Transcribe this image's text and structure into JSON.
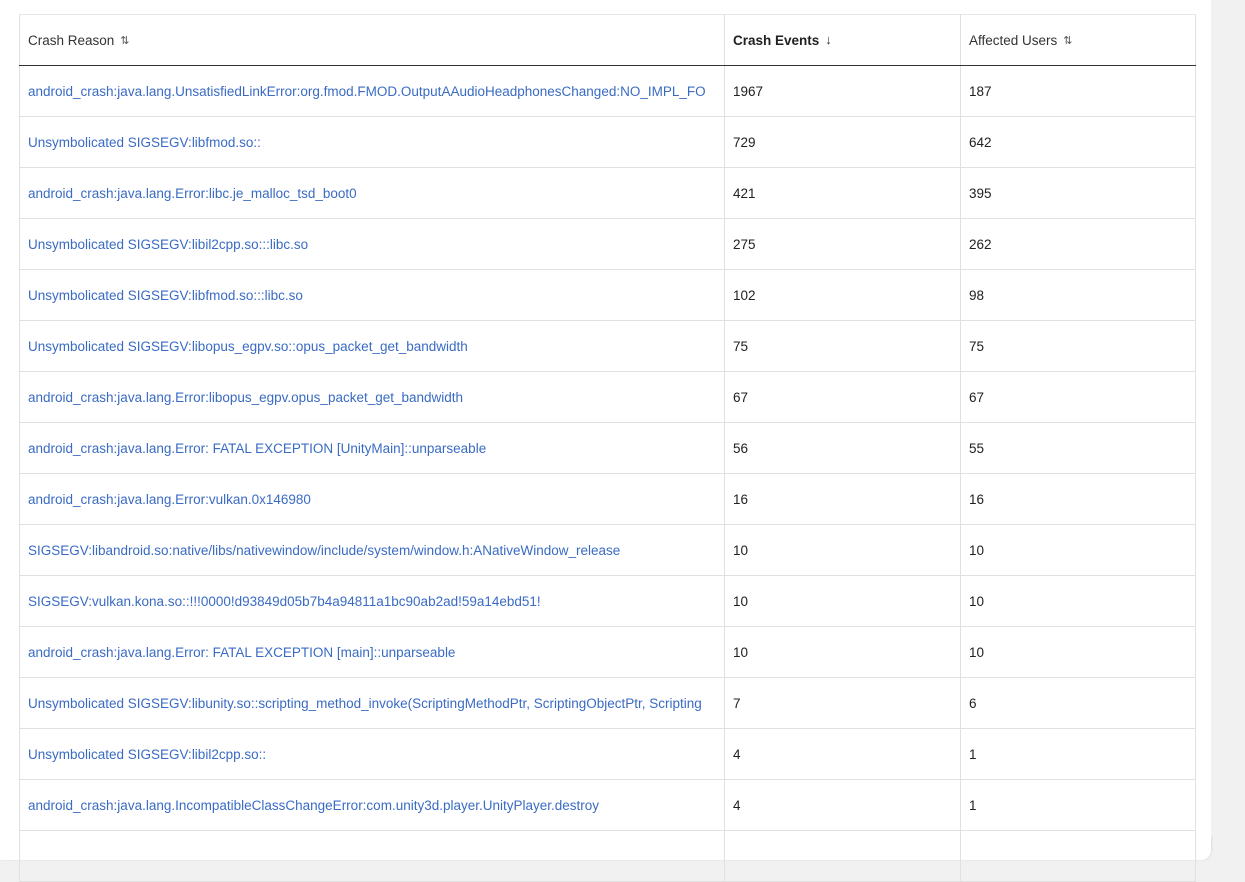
{
  "table": {
    "columns": [
      {
        "label": "Crash Reason",
        "sort_icon": "⇅",
        "sorted": false
      },
      {
        "label": "Crash Events",
        "sort_icon": "↓",
        "sorted": true
      },
      {
        "label": "Affected Users",
        "sort_icon": "⇅",
        "sorted": false
      }
    ],
    "rows": [
      {
        "reason": "android_crash:java.lang.UnsatisfiedLinkError:org.fmod.FMOD.OutputAAudioHeadphonesChanged:NO_IMPL_FO",
        "events": "1967",
        "users": "187"
      },
      {
        "reason": "Unsymbolicated SIGSEGV:libfmod.so::",
        "events": "729",
        "users": "642"
      },
      {
        "reason": "android_crash:java.lang.Error:libc.je_malloc_tsd_boot0",
        "events": "421",
        "users": "395"
      },
      {
        "reason": "Unsymbolicated SIGSEGV:libil2cpp.so:::libc.so",
        "events": "275",
        "users": "262"
      },
      {
        "reason": "Unsymbolicated SIGSEGV:libfmod.so:::libc.so",
        "events": "102",
        "users": "98"
      },
      {
        "reason": "Unsymbolicated SIGSEGV:libopus_egpv.so::opus_packet_get_bandwidth",
        "events": "75",
        "users": "75"
      },
      {
        "reason": "android_crash:java.lang.Error:libopus_egpv.opus_packet_get_bandwidth",
        "events": "67",
        "users": "67"
      },
      {
        "reason": "android_crash:java.lang.Error: FATAL EXCEPTION [UnityMain]::unparseable",
        "events": "56",
        "users": "55"
      },
      {
        "reason": "android_crash:java.lang.Error:vulkan.0x146980",
        "events": "16",
        "users": "16"
      },
      {
        "reason": "SIGSEGV:libandroid.so:native/libs/nativewindow/include/system/window.h:ANativeWindow_release",
        "events": "10",
        "users": "10"
      },
      {
        "reason": "SIGSEGV:vulkan.kona.so::!!!0000!d93849d05b7b4a94811a1bc90ab2ad!59a14ebd51!",
        "events": "10",
        "users": "10"
      },
      {
        "reason": "android_crash:java.lang.Error: FATAL EXCEPTION [main]::unparseable",
        "events": "10",
        "users": "10"
      },
      {
        "reason": "Unsymbolicated SIGSEGV:libunity.so::scripting_method_invoke(ScriptingMethodPtr, ScriptingObjectPtr, Scripting",
        "events": "7",
        "users": "6"
      },
      {
        "reason": "Unsymbolicated SIGSEGV:libil2cpp.so::",
        "events": "4",
        "users": "1"
      },
      {
        "reason": "android_crash:java.lang.IncompatibleClassChangeError:com.unity3d.player.UnityPlayer.destroy",
        "events": "4",
        "users": "1"
      },
      {
        "reason": "",
        "events": "",
        "users": ""
      }
    ]
  },
  "colors": {
    "link": "#3a6bc4",
    "header_rule": "#333333",
    "grid": "#e0e0e0",
    "page_bg": "#f1f1f1"
  }
}
